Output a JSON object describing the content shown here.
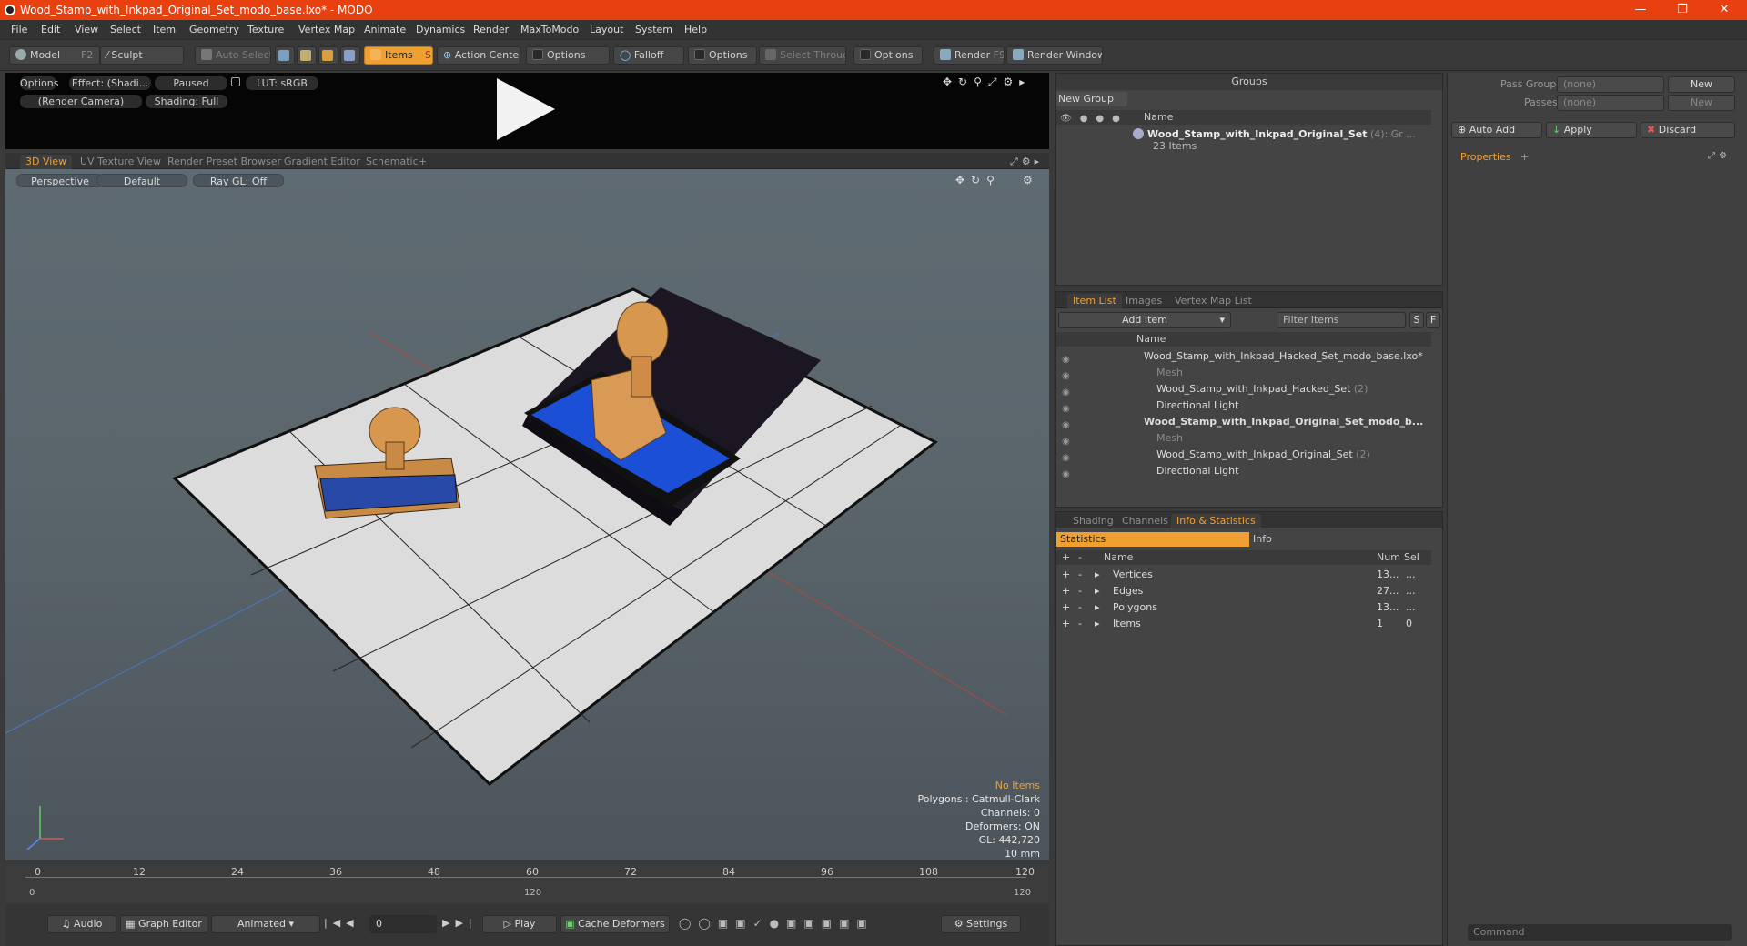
{
  "window": {
    "title": "Wood_Stamp_with_Inkpad_Original_Set_modo_base.lxo* - MODO"
  },
  "menu": [
    "File",
    "Edit",
    "View",
    "Select",
    "Item",
    "Geometry",
    "Texture",
    "Vertex Map",
    "Animate",
    "Dynamics",
    "Render",
    "MaxToModo",
    "Layout",
    "System",
    "Help"
  ],
  "toolbar": {
    "model": "Model",
    "model_key": "F2",
    "sculpt": "Sculpt",
    "auto_select": "Auto Select",
    "items": "Items",
    "items_key": "S",
    "action_center": "Action Center",
    "options1": "Options",
    "falloff": "Falloff",
    "options2": "Options",
    "select_through": "Select Through",
    "options3": "Options",
    "render": "Render",
    "render_key": "F9",
    "render_window": "Render Window"
  },
  "preview": {
    "options": "Options",
    "effect": "Effect: (Shadi...",
    "paused": "Paused",
    "lut": "LUT: sRGB",
    "camera": "(Render Camera)",
    "shading": "Shading: Full"
  },
  "viewport_tabs": [
    "3D View",
    "UV Texture View",
    "Render Preset Browser",
    "Gradient Editor",
    "Schematic"
  ],
  "viewport": {
    "perspective": "Perspective",
    "default": "Default",
    "raygl": "Ray GL: Off",
    "stats": {
      "no_items": "No Items",
      "polygons": "Polygons : Catmull-Clark",
      "channels": "Channels: 0",
      "deformers": "Deformers: ON",
      "gl": "GL: 442,720",
      "units": "10 mm"
    }
  },
  "timeline": {
    "ticks": [
      "0",
      "12",
      "24",
      "36",
      "48",
      "60",
      "72",
      "84",
      "96",
      "108",
      "120"
    ],
    "sub": [
      "0",
      "120",
      "120"
    ]
  },
  "transport": {
    "audio": "Audio",
    "graph_editor": "Graph Editor",
    "animated": "Animated",
    "frame": "0",
    "play": "Play",
    "cache": "Cache Deformers",
    "settings": "Settings"
  },
  "groups": {
    "title": "Groups",
    "new_group": "New Group",
    "col_name": "Name",
    "item_name": "Wood_Stamp_with_Inkpad_Original_Set",
    "item_count": "(4)",
    "item_suffix": ": Gr ...",
    "item_sub": "23 Items"
  },
  "pass": {
    "pass_groups": "Pass Groups",
    "passes": "Passes",
    "none1": "(none)",
    "none2": "(none)",
    "new1": "New",
    "new2": "New",
    "auto_add": "Auto Add",
    "apply": "Apply",
    "discard": "Discard",
    "properties": "Properties"
  },
  "itemlist": {
    "tabs": [
      "Item List",
      "Images",
      "Vertex Map List"
    ],
    "add_item": "Add Item",
    "filter": "Filter Items",
    "s": "S",
    "f": "F",
    "col_name": "Name",
    "rows": [
      {
        "label": "Wood_Stamp_with_Inkpad_Hacked_Set_modo_base.lxo*",
        "count": "",
        "style": "normal"
      },
      {
        "label": "Mesh",
        "count": "",
        "style": "mute"
      },
      {
        "label": "Wood_Stamp_with_Inkpad_Hacked_Set",
        "count": "(2)",
        "style": "normal"
      },
      {
        "label": "Directional Light",
        "count": "",
        "style": "normal"
      },
      {
        "label": "Wood_Stamp_with_Inkpad_Original_Set_modo_b...",
        "count": "",
        "style": "bold"
      },
      {
        "label": "Mesh",
        "count": "",
        "style": "mute"
      },
      {
        "label": "Wood_Stamp_with_Inkpad_Original_Set",
        "count": "(2)",
        "style": "normal"
      },
      {
        "label": "Directional Light",
        "count": "",
        "style": "normal"
      }
    ]
  },
  "stats_panel": {
    "tabs": [
      "Shading",
      "Channels",
      "Info & Statistics"
    ],
    "statistics": "Statistics",
    "info": "Info",
    "cols": {
      "name": "Name",
      "num": "Num",
      "sel": "Sel"
    },
    "rows": [
      {
        "name": "Vertices",
        "num": "13...",
        "sel": "..."
      },
      {
        "name": "Edges",
        "num": "27...",
        "sel": "..."
      },
      {
        "name": "Polygons",
        "num": "13...",
        "sel": "..."
      },
      {
        "name": "Items",
        "num": "1",
        "sel": "0"
      }
    ]
  },
  "command": {
    "placeholder": "Command"
  }
}
